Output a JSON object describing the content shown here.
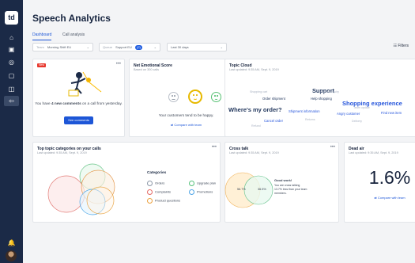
{
  "app": {
    "logo": "td",
    "title": "Speech Analytics"
  },
  "sidebar": {
    "items": [
      {
        "name": "home-icon",
        "glyph": "⌂"
      },
      {
        "name": "clipboard-icon",
        "glyph": "▣"
      },
      {
        "name": "compass-icon",
        "glyph": "◎"
      },
      {
        "name": "chat-icon",
        "glyph": "▢"
      },
      {
        "name": "team-icon",
        "glyph": "◫"
      },
      {
        "name": "logout-icon",
        "glyph": "⇦"
      }
    ],
    "bottom": [
      {
        "name": "bell-icon",
        "glyph": "🔔"
      },
      {
        "name": "help-icon",
        "glyph": "?"
      }
    ]
  },
  "tabs": [
    {
      "label": "Dashboard",
      "active": true
    },
    {
      "label": "Call analysis",
      "active": false
    }
  ],
  "filters": {
    "team": {
      "label": "Team",
      "value": "Morning Shift EU"
    },
    "queue": {
      "label": "Queue",
      "value": "Support EU",
      "badge": "(2)"
    },
    "date": {
      "value": "Last 30 days"
    },
    "button": "Filters"
  },
  "comments_card": {
    "tag": "New",
    "message_1": "You have ",
    "message_bold": "4 new comments",
    "message_2": " on a call from yesterday.",
    "button": "See comments"
  },
  "emotional_score": {
    "title": "Net Emotional Score",
    "subtitle": "Based on 300 calls",
    "message": "Your customers tend to be happy.",
    "link": "Compare with team"
  },
  "topic_cloud": {
    "title": "Topic Cloud",
    "subtitle": "Last updated: 9:35 AM, Sept. 9, 2019",
    "words": [
      {
        "text": "Support",
        "size": 7.3,
        "color": "#22375d",
        "bold": true
      },
      {
        "text": "Order shipment",
        "size": 4.2,
        "color": "#22375d"
      },
      {
        "text": "Help shopping",
        "size": 4.2,
        "color": "#22375d"
      },
      {
        "text": "Shopping experience",
        "size": 7.5,
        "color": "#2454db",
        "bold": true
      },
      {
        "text": "Where's my order?",
        "size": 7.5,
        "color": "#22375d",
        "bold": true
      },
      {
        "text": "Shipment information",
        "size": 4.2,
        "color": "#2454db"
      },
      {
        "text": "Angry customer",
        "size": 4.2,
        "color": "#2454db"
      },
      {
        "text": "Find new item",
        "size": 4.2,
        "color": "#2454db"
      },
      {
        "text": "Cancel order",
        "size": 4.2,
        "color": "#2454db"
      },
      {
        "text": "Shopping cart",
        "size": 3.6,
        "color": "#a9b2c2"
      },
      {
        "text": "Product inquiry",
        "size": 3.6,
        "color": "#a9b2c2"
      },
      {
        "text": "Team update",
        "size": 3.6,
        "color": "#a9b2c2"
      },
      {
        "text": "Returns",
        "size": 3.6,
        "color": "#a9b2c2"
      },
      {
        "text": "Delivery",
        "size": 3.6,
        "color": "#a9b2c2"
      },
      {
        "text": "Refund",
        "size": 3.6,
        "color": "#a9b2c2"
      }
    ]
  },
  "topic_categories": {
    "title": "Top topic categories on your calls",
    "subtitle": "Last updated: 9:35 AM, Sept. 9, 2019",
    "legend_title": "Categories",
    "categories": [
      {
        "label": "Orders",
        "color": "#8d98a8"
      },
      {
        "label": "Upgrade plan",
        "color": "#56c27b"
      },
      {
        "label": "Complaints",
        "color": "#e46b66"
      },
      {
        "label": "Promotions",
        "color": "#4ea5e6"
      },
      {
        "label": "Product questions",
        "color": "#eca13f"
      }
    ]
  },
  "cross_talk": {
    "title": "Cross talk",
    "subtitle": "Last updated: 9:35 AM, Sept. 9, 2019",
    "left_value": "56.7%",
    "right_value": "36.5%",
    "message_title": "Good work!",
    "message": "You are cross talking 13.7% less than your team members."
  },
  "dead_air": {
    "title": "Dead air",
    "subtitle": "Last updated: 9:35 AM, Sept. 9, 2019",
    "value": "1.6%",
    "link": "Compare with team"
  }
}
